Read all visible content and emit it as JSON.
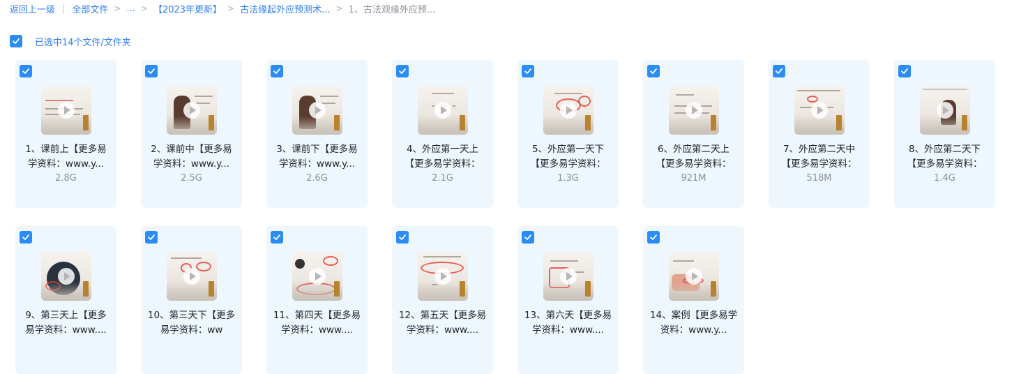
{
  "breadcrumb": {
    "back": "返回上一级",
    "items": [
      "全部文件",
      "...",
      "【2023年更新】",
      "古法缘起外应预测术...",
      "1、古法观缘外应预..."
    ]
  },
  "selection": {
    "label": "已选中14个文件/文件夹",
    "checked": true
  },
  "colors": {
    "accent": "#2b8cf7",
    "card_bg": "#eef7fd",
    "link": "#2f7cf6",
    "muted": "#8a8f99"
  },
  "icons": {
    "checkbox": "check-icon",
    "play": "play-icon"
  },
  "files": [
    {
      "name": "1、课前上【更多易学资料：www.y...",
      "size": "2.8G"
    },
    {
      "name": "2、课前中【更多易学资料：www.y...",
      "size": "2.5G"
    },
    {
      "name": "3、课前下【更多易学资料：www.y...",
      "size": "2.6G"
    },
    {
      "name": "4、外应第一天上【更多易学资料：",
      "size": "2.1G"
    },
    {
      "name": "5、外应第一天下【更多易学资料：",
      "size": "1.3G"
    },
    {
      "name": "6、外应第二天上【更多易学资料：",
      "size": "921M"
    },
    {
      "name": "7、外应第二天中【更多易学资料：",
      "size": "518M"
    },
    {
      "name": "8、外应第二天下【更多易学资料：",
      "size": "1.4G"
    },
    {
      "name": "9、第三天上【更多易学资料：www....",
      "size": ""
    },
    {
      "name": "10、第三天下【更多易学资料：ww",
      "size": ""
    },
    {
      "name": "11、第四天【更多易学资料：www....",
      "size": ""
    },
    {
      "name": "12、第五天【更多易学资料：www....",
      "size": ""
    },
    {
      "name": "13、第六天【更多易学资料：www....",
      "size": ""
    },
    {
      "name": "14、案例【更多易学资料：www.y...",
      "size": ""
    }
  ]
}
